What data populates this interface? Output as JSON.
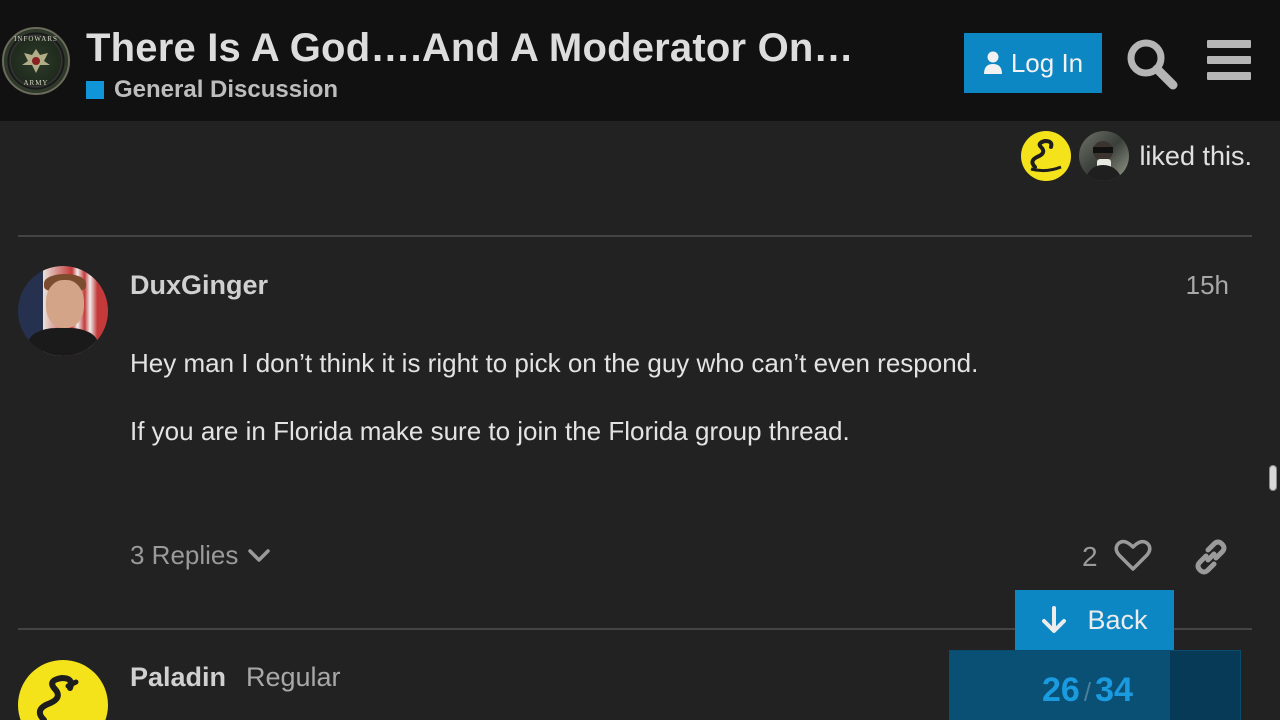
{
  "header": {
    "topic_title": "There Is A God….And A Moderator On…",
    "category_name": "General Discussion",
    "login_label": "Log In",
    "logo_text_top": "INFOWARS",
    "logo_text_bottom": "ARMY"
  },
  "previous_post": {
    "liked_text": "liked this."
  },
  "post": {
    "username": "DuxGinger",
    "date": "15h",
    "paragraphs": [
      "Hey man I don’t think it is right to pick on the guy who can’t even respond.",
      "If you are in Florida make sure to join the Florida group thread."
    ],
    "replies_label": "3 Replies",
    "like_count": "2"
  },
  "next_post": {
    "username": "Paladin",
    "user_title": "Regular"
  },
  "timeline": {
    "back_label": "Back",
    "current": "26",
    "separator": "/",
    "total": "34",
    "progress_fraction": 0.76
  },
  "colors": {
    "header_bg": "#111111",
    "page_bg": "#222222",
    "accent": "#0d86c4",
    "category": "#0f95d8"
  }
}
